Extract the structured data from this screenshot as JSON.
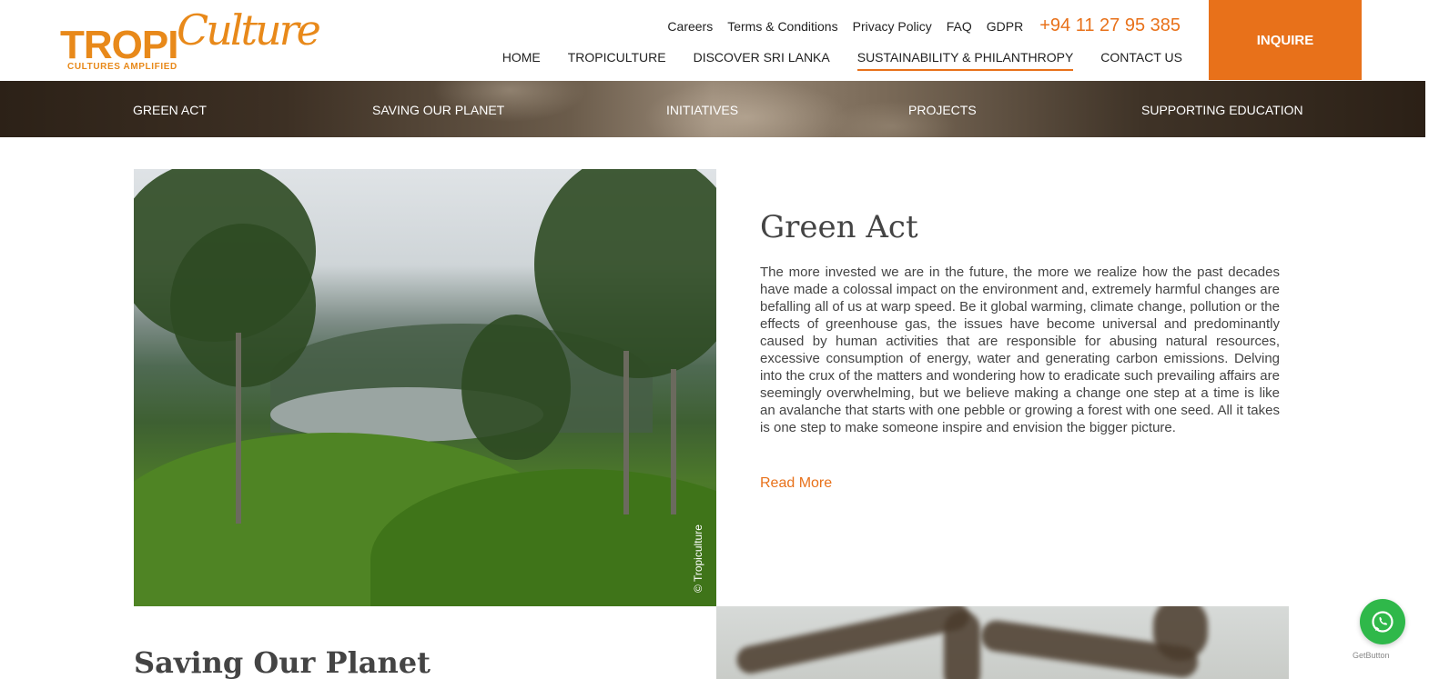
{
  "logo": {
    "word_bold": "TROPI",
    "word_script": "Culture",
    "tagline": "CULTURES AMPLIFIED"
  },
  "top_links": [
    "Careers",
    "Terms & Conditions",
    "Privacy Policy",
    "FAQ",
    "GDPR"
  ],
  "phone": "+94 11 27 95 385",
  "main_nav": [
    "HOME",
    "TROPICULTURE",
    "DISCOVER SRI LANKA",
    "SUSTAINABILITY & PHILANTHROPY",
    "CONTACT US"
  ],
  "active_nav": "SUSTAINABILITY & PHILANTHROPY",
  "inquire_label": "INQUIRE",
  "sub_nav": [
    "GREEN ACT",
    "SAVING OUR PLANET",
    "INITIATIVES",
    "PROJECTS",
    "SUPPORTING EDUCATION"
  ],
  "green_act": {
    "heading": "Green Act",
    "body": "The more invested we are in the future, the more we realize how the past decades have made a colossal impact on the environment and, extremely harmful changes are befalling all of us at warp speed. Be it global warming, climate change, pollution or the effects of greenhouse gas, the issues have become universal and predominantly caused by human activities that are responsible for abusing natural resources, excessive consumption of energy, water and generating carbon emissions. Delving into the crux of the matters and wondering how to eradicate such prevailing affairs are seemingly overwhelming, but we believe making a change one step at a time is like an avalanche that starts with one pebble or growing a forest with one seed. All it takes is one step to make someone inspire and envision the bigger picture.",
    "read_more": "Read More",
    "photo_credit": "© Tropiculture"
  },
  "saving_planet": {
    "heading": "Saving Our Planet"
  },
  "whatsapp": {
    "icon": "whatsapp-icon",
    "credit": "GetButton"
  },
  "colors": {
    "brand_orange": "#e8711a",
    "logo_orange": "#e8891a",
    "whatsapp_green": "#2fb84a"
  }
}
